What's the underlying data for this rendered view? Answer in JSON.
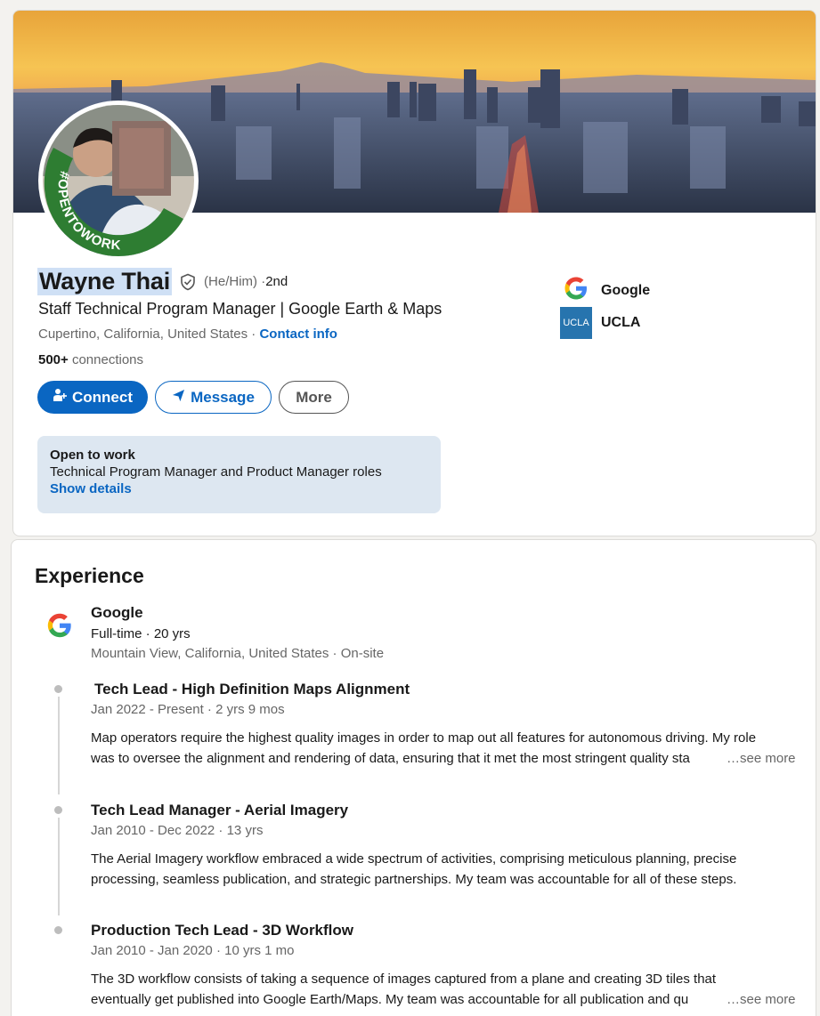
{
  "profile": {
    "name": "Wayne Thai",
    "pronouns": "(He/Him) ·",
    "degree": " 2nd",
    "headline": "Staff Technical Program Manager | Google Earth & Maps",
    "location": "Cupertino, California, United States · ",
    "contact_info": "Contact info",
    "connections_count": "500+",
    "connections_label": " connections",
    "avatar_badge": "#OPENTOWORK",
    "buttons": {
      "connect": "Connect",
      "message": "Message",
      "more": "More"
    },
    "open_to_work": {
      "title": "Open to work",
      "roles": "Technical Program Manager and Product Manager roles",
      "details_link": "Show details"
    },
    "orgs": [
      {
        "name": "Google",
        "logo": "google-logo"
      },
      {
        "name": "UCLA",
        "logo": "ucla-logo",
        "logo_text": "UCLA"
      }
    ]
  },
  "experience": {
    "heading": "Experience",
    "company": {
      "name": "Google",
      "type": "Full-time · 20 yrs",
      "location": "Mountain View, California, United States · On-site"
    },
    "roles": [
      {
        "title": "Tech Lead - High Definition Maps Alignment",
        "dates": "Jan 2022 - Present · 2 yrs 9 mos",
        "desc_line1": "Map operators require the highest quality images in order to map out all features for autonomous driving. My role",
        "desc_line2": "was to oversee the alignment and rendering of data, ensuring that it met the most stringent quality sta",
        "see_more": "…see more"
      },
      {
        "title": "Tech Lead Manager - Aerial Imagery",
        "dates": "Jan 2010 - Dec 2022 · 13 yrs",
        "desc_line1": "The Aerial Imagery workflow embraced a wide spectrum of activities, comprising meticulous planning, precise",
        "desc_line2": "processing, seamless publication, and strategic partnerships. My team was accountable for all of these steps.",
        "see_more": ""
      },
      {
        "title": "Production Tech Lead - 3D Workflow",
        "dates": "Jan 2010 - Jan 2020 · 10 yrs 1 mo",
        "desc_line1": "The 3D workflow consists of taking a sequence of images captured from a plane and creating 3D tiles that",
        "desc_line2": "eventually get published into Google Earth/Maps. My team was accountable for all publication and qu",
        "see_more": "…see more"
      }
    ]
  },
  "colors": {
    "brand_blue": "#0a66c2",
    "open_to_work_green": "#2e7d32",
    "page_bg": "#f3f2ef"
  }
}
